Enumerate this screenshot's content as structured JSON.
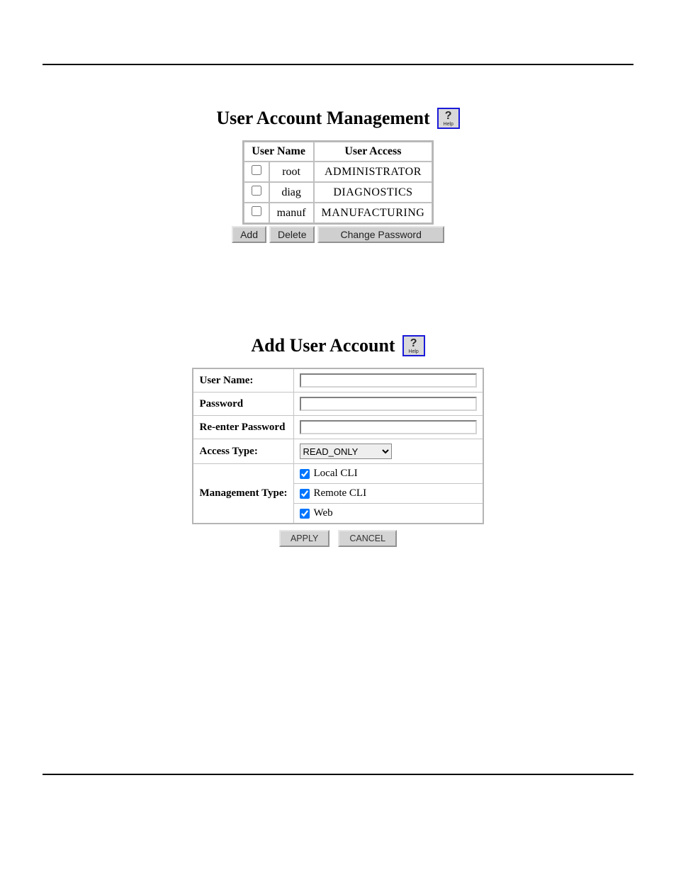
{
  "section1": {
    "title": "User Account Management",
    "help_label": "Help",
    "columns": {
      "name": "User Name",
      "access": "User Access"
    },
    "rows": [
      {
        "checked": false,
        "name": "root",
        "access": "ADMINISTRATOR"
      },
      {
        "checked": false,
        "name": "diag",
        "access": "DIAGNOSTICS"
      },
      {
        "checked": false,
        "name": "manuf",
        "access": "MANUFACTURING"
      }
    ],
    "buttons": {
      "add": "Add",
      "delete": "Delete",
      "change_password": "Change Password"
    }
  },
  "section2": {
    "title": "Add User Account",
    "help_label": "Help",
    "labels": {
      "username": "User Name:",
      "password": "Password",
      "reenter": "Re-enter Password",
      "access_type": "Access Type:",
      "mgmt_type": "Management Type:"
    },
    "values": {
      "username": "",
      "password": "",
      "reenter": "",
      "access_type": "READ_ONLY"
    },
    "mgmt_options": [
      {
        "label": "Local CLI",
        "checked": true
      },
      {
        "label": "Remote CLI",
        "checked": true
      },
      {
        "label": "Web",
        "checked": true
      }
    ],
    "buttons": {
      "apply": "APPLY",
      "cancel": "CANCEL"
    }
  }
}
